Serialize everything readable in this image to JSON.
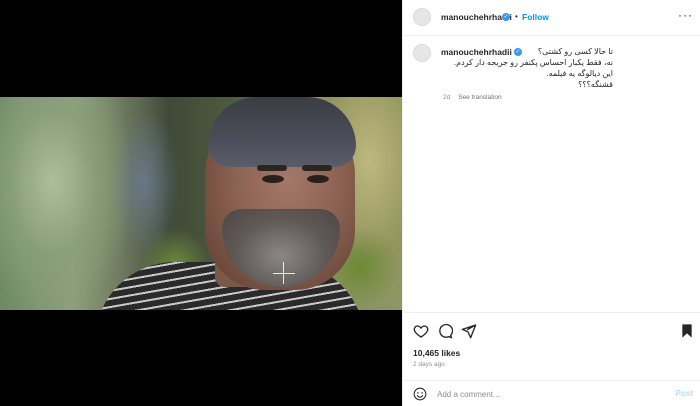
{
  "post": {
    "username": "manouchehrhadii",
    "follow_label": "Follow",
    "dot_separator": "•",
    "more_glyph": "···",
    "caption_lines": [
      "تا حالا کسی رو کشتی؟",
      "نه، فقط یکبار احساس پکنفر رو جریحه دار کردم.",
      "این دیالوگه یه فیلمه.",
      "قشنگه؟؟؟"
    ],
    "time_ago": "2d",
    "see_translation": "See translation",
    "likes": "10,465 likes",
    "date": "2 days ago",
    "comment_placeholder": "Add a comment...",
    "post_label": "Post"
  },
  "colors": {
    "accent": "#0095f6",
    "verified": "#3897f0",
    "muted": "#8e8e8e",
    "post_disabled": "#b2dffc"
  },
  "icons": {
    "verified": "verified-badge-icon",
    "like": "heart-icon",
    "comment": "comment-bubble-icon",
    "share": "paper-plane-icon",
    "save": "bookmark-icon",
    "emoji": "smiley-icon"
  }
}
